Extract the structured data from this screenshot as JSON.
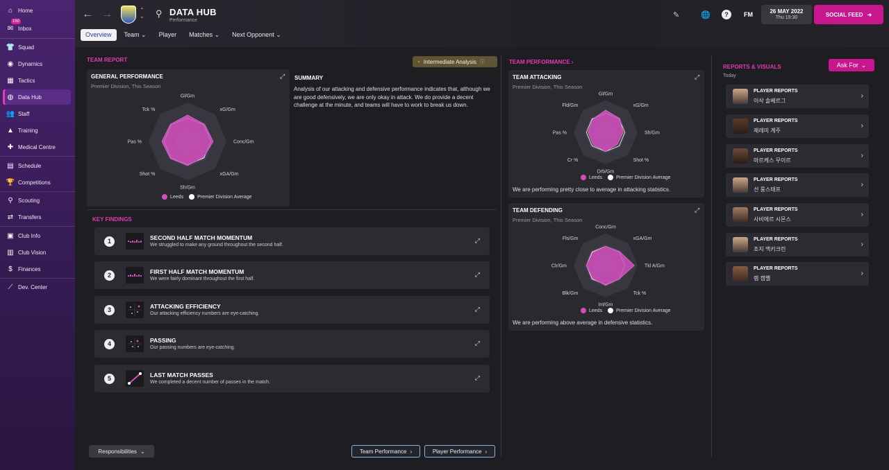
{
  "sidebar": {
    "items": [
      {
        "label": "Home"
      },
      {
        "label": "Inbox",
        "badge": "150"
      },
      {
        "label": "Squad"
      },
      {
        "label": "Dynamics"
      },
      {
        "label": "Tactics"
      },
      {
        "label": "Data Hub"
      },
      {
        "label": "Staff"
      },
      {
        "label": "Training"
      },
      {
        "label": "Medical Centre"
      },
      {
        "label": "Schedule"
      },
      {
        "label": "Competitions"
      },
      {
        "label": "Scouting"
      },
      {
        "label": "Transfers"
      },
      {
        "label": "Club Info"
      },
      {
        "label": "Club Vision"
      },
      {
        "label": "Finances"
      },
      {
        "label": "Dev. Center"
      }
    ]
  },
  "header": {
    "title": "DATA HUB",
    "subtitle": "Performance",
    "fm": "FM",
    "date": "26 MAY 2022",
    "time": "Thu 19:30",
    "social_feed": "SOCIAL FEED"
  },
  "tabs": [
    {
      "label": "Overview"
    },
    {
      "label": "Team ⌄"
    },
    {
      "label": "Player"
    },
    {
      "label": "Matches ⌄"
    },
    {
      "label": "Next Opponent ⌄"
    }
  ],
  "team_report": {
    "section_title": "TEAM REPORT",
    "analysis": "Intermediate Analysis",
    "general": {
      "title": "GENERAL PERFORMANCE",
      "subtitle": "Premier Division, This Season",
      "axes": [
        "Gl/Gm",
        "xG/Gm",
        "Conc/Gm",
        "xGA/Gm",
        "Sh/Gm",
        "Shot %",
        "Pas %",
        "Tck %"
      ],
      "leeds": [
        0.68,
        0.62,
        0.66,
        0.58,
        0.62,
        0.62,
        0.66,
        0.62
      ],
      "average": [
        0.6,
        0.6,
        0.6,
        0.6,
        0.6,
        0.6,
        0.6,
        0.6
      ]
    },
    "summary_title": "SUMMARY",
    "summary_text": "Analysis of our attacking and defensive performance indicates that, although we are good defensively, we are only okay in attack. We do provide a decent challenge at the minute, and teams will have to work to break us down."
  },
  "legend": {
    "leeds": "Leeds",
    "average": "Premier Division Average"
  },
  "key_findings": {
    "title": "KEY FINDINGS",
    "items": [
      {
        "num": "1",
        "title": "SECOND HALF MATCH MOMENTUM",
        "desc": "We struggled to make any ground throughout the second half."
      },
      {
        "num": "2",
        "title": "FIRST HALF MATCH MOMENTUM",
        "desc": "We were fairly dominant throughout the first half."
      },
      {
        "num": "3",
        "title": "ATTACKING EFFICIENCY",
        "desc": "Our attacking efficiency numbers are eye-catching."
      },
      {
        "num": "4",
        "title": "PASSING",
        "desc": "Our passing numbers are eye-catching."
      },
      {
        "num": "5",
        "title": "LAST MATCH PASSES",
        "desc": "We completed a decent number of passes in the match."
      }
    ]
  },
  "buttons": {
    "responsibilities": "Responsibilities",
    "team_performance": "Team Performance",
    "player_performance": "Player Performance"
  },
  "team_performance": {
    "title": "TEAM PERFORMANCE",
    "attacking": {
      "title": "TEAM ATTACKING",
      "subtitle": "Premier Division, This Season",
      "axes": [
        "Gl/Gm",
        "xG/Gm",
        "Sh/Gm",
        "Shot %",
        "Drb/Gm",
        "Cr %",
        "Pas %",
        "Fld/Gm"
      ],
      "leeds": [
        0.7,
        0.62,
        0.55,
        0.52,
        0.6,
        0.55,
        0.55,
        0.58
      ],
      "average": [
        0.6,
        0.6,
        0.6,
        0.6,
        0.6,
        0.6,
        0.6,
        0.6
      ],
      "note": "We are performing pretty close to average in attacking statistics."
    },
    "defending": {
      "title": "TEAM DEFENDING",
      "subtitle": "Premier Division, This Season",
      "axes": [
        "Conc/Gm",
        "xGA/Gm",
        "Tkl A/Gm",
        "Tck %",
        "Int/Gm",
        "Blk/Gm",
        "Clr/Gm",
        "Fls/Gm"
      ],
      "leeds": [
        0.6,
        0.62,
        0.9,
        0.6,
        0.62,
        0.58,
        0.6,
        0.58
      ],
      "average": [
        0.6,
        0.6,
        0.6,
        0.6,
        0.6,
        0.6,
        0.6,
        0.6
      ],
      "note": "We are performing above average in defensive statistics."
    }
  },
  "reports": {
    "title": "REPORTS & VISUALS",
    "today": "Today",
    "ask_for": "Ask For",
    "items": [
      {
        "title": "PLAYER REPORTS",
        "name": "이삭 솔베르그"
      },
      {
        "title": "PLAYER REPORTS",
        "name": "제레미 계주"
      },
      {
        "title": "PLAYER REPORTS",
        "name": "마르케스 무이르"
      },
      {
        "title": "PLAYER REPORTS",
        "name": "선 룽스태프"
      },
      {
        "title": "PLAYER REPORTS",
        "name": "사비에르 시몬스"
      },
      {
        "title": "PLAYER REPORTS",
        "name": "조지 맥키크런"
      },
      {
        "title": "PLAYER REPORTS",
        "name": "렘 캠벨"
      }
    ]
  },
  "colors": {
    "accent": "#c8178e",
    "leeds": "#d24fc0",
    "average": "#ffffff"
  }
}
